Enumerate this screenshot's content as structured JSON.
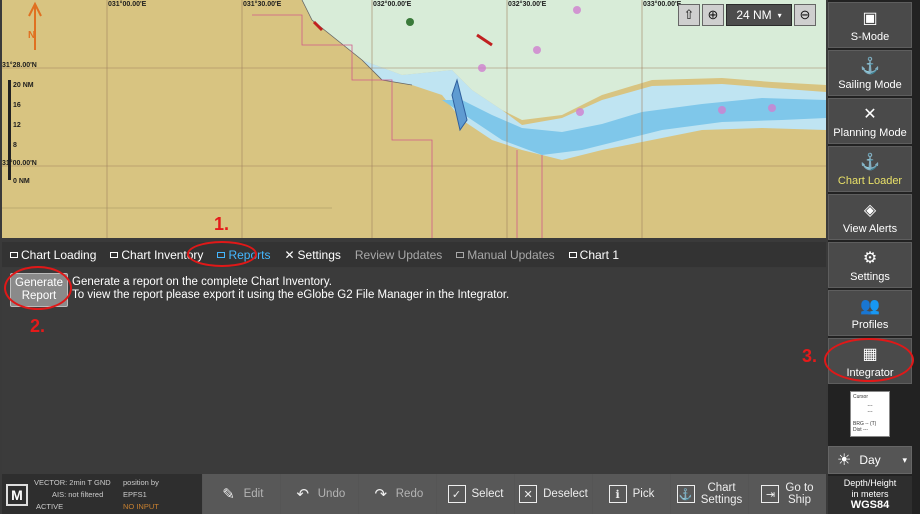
{
  "map": {
    "lon_labels": [
      "031°00.00'E",
      "031°30.00'E",
      "032°00.00'E",
      "032°30.00'E",
      "033°00.00'E"
    ],
    "lat_labels": [
      "31°28.00'N",
      "31°00.00'N"
    ],
    "scalebar": [
      "20 NM",
      "16",
      "12",
      "8",
      "0 NM"
    ],
    "north_label": "N",
    "scale": "24 NM"
  },
  "tabs": [
    {
      "label": "Chart Loading"
    },
    {
      "label": "Chart Inventory"
    },
    {
      "label": "Reports"
    },
    {
      "label": "Settings"
    },
    {
      "label": "Review Updates"
    },
    {
      "label": "Manual Updates"
    },
    {
      "label": "Chart 1"
    }
  ],
  "panel": {
    "button": "Generate Report",
    "button_line1": "Generate",
    "button_line2": "Report",
    "line1": "Generate a report on the complete Chart Inventory.",
    "line2": "To view the report please export it using the eGlobe G2 File Manager in the Integrator."
  },
  "annotations": {
    "a1": "1.",
    "a2": "2.",
    "a3": "3."
  },
  "status": {
    "vector": "VECTOR: 2min T GND",
    "ais": "AIS: not filtered",
    "active": "ACTIVE",
    "position_by": "position by",
    "epfs": "EPFS1",
    "no_input": "NO INPUT",
    "logo": "M"
  },
  "bottom": [
    {
      "label": "Edit",
      "icon": "✎"
    },
    {
      "label": "Undo",
      "icon": "↶"
    },
    {
      "label": "Redo",
      "icon": "↷"
    },
    {
      "label": "Select",
      "icon": "✓"
    },
    {
      "label": "Deselect",
      "icon": "✕"
    },
    {
      "label": "Pick",
      "icon": "ℹ"
    },
    {
      "label": "Chart Settings",
      "line1": "Chart",
      "line2": "Settings",
      "icon": "⚓"
    },
    {
      "label": "Go to Ship",
      "line1": "Go to",
      "line2": "Ship",
      "icon": "⇥"
    }
  ],
  "sidebar": [
    {
      "label": "S-Mode",
      "icon": "▣"
    },
    {
      "label": "Sailing Mode",
      "icon": "⚓"
    },
    {
      "label": "Planning Mode",
      "icon": "✕"
    },
    {
      "label": "Chart Loader",
      "icon": "⚓"
    },
    {
      "label": "View Alerts",
      "icon": "◈"
    },
    {
      "label": "Settings",
      "icon": "⚙"
    },
    {
      "label": "Profiles",
      "icon": "👥"
    },
    {
      "label": "Integrator",
      "icon": "▦"
    }
  ],
  "cursor_box": {
    "title": "Cursor",
    "l1": "---",
    "l2": "---",
    "brg": "BRG  --  (T)",
    "dist": "Dist  ---"
  },
  "day": "Day",
  "depth": {
    "line1": "Depth/Height",
    "line2": "in meters",
    "datum": "WGS84"
  }
}
